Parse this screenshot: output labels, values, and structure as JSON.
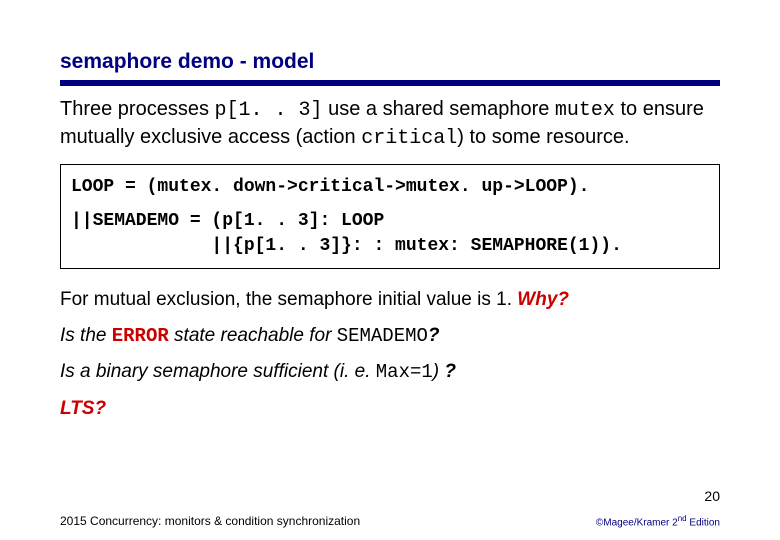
{
  "title": "semaphore demo - model",
  "intro": {
    "part1": "Three processes ",
    "code1": "p[1. . 3]",
    "part2": " use a shared semaphore ",
    "code2": "mutex",
    "part3": " to ensure mutually exclusive access (action ",
    "code3": "critical",
    "part4": ") to some resource."
  },
  "code": {
    "line1": "LOOP = (mutex. down->critical->mutex. up->LOOP).",
    "line2": "||SEMADEMO = (p[1. . 3]: LOOP",
    "line3": "             ||{p[1. . 3]}: : mutex: SEMAPHORE(1))."
  },
  "body": {
    "line1a": "For mutual exclusion, the semaphore initial value is 1. ",
    "line1b": "Why?",
    "line2a": "Is the ",
    "line2code": "ERROR",
    "line2b": " state reachable for ",
    "line2code2": "SEMADEMO",
    "line2c": "?",
    "line3a": "Is a ",
    "line3b": "binary semaphore ",
    "line3c": "sufficient (i. e. ",
    "line3code": "Max=1",
    "line3d": ") ",
    "line3e": "?",
    "line4": "LTS?"
  },
  "page_number": "20",
  "footer_left": "2015  Concurrency: monitors & condition synchronization",
  "copyright_prefix": "©Magee/Kramer ",
  "copyright_edition_num": "2",
  "copyright_edition_suffix": "nd",
  "copyright_tail": " Edition"
}
